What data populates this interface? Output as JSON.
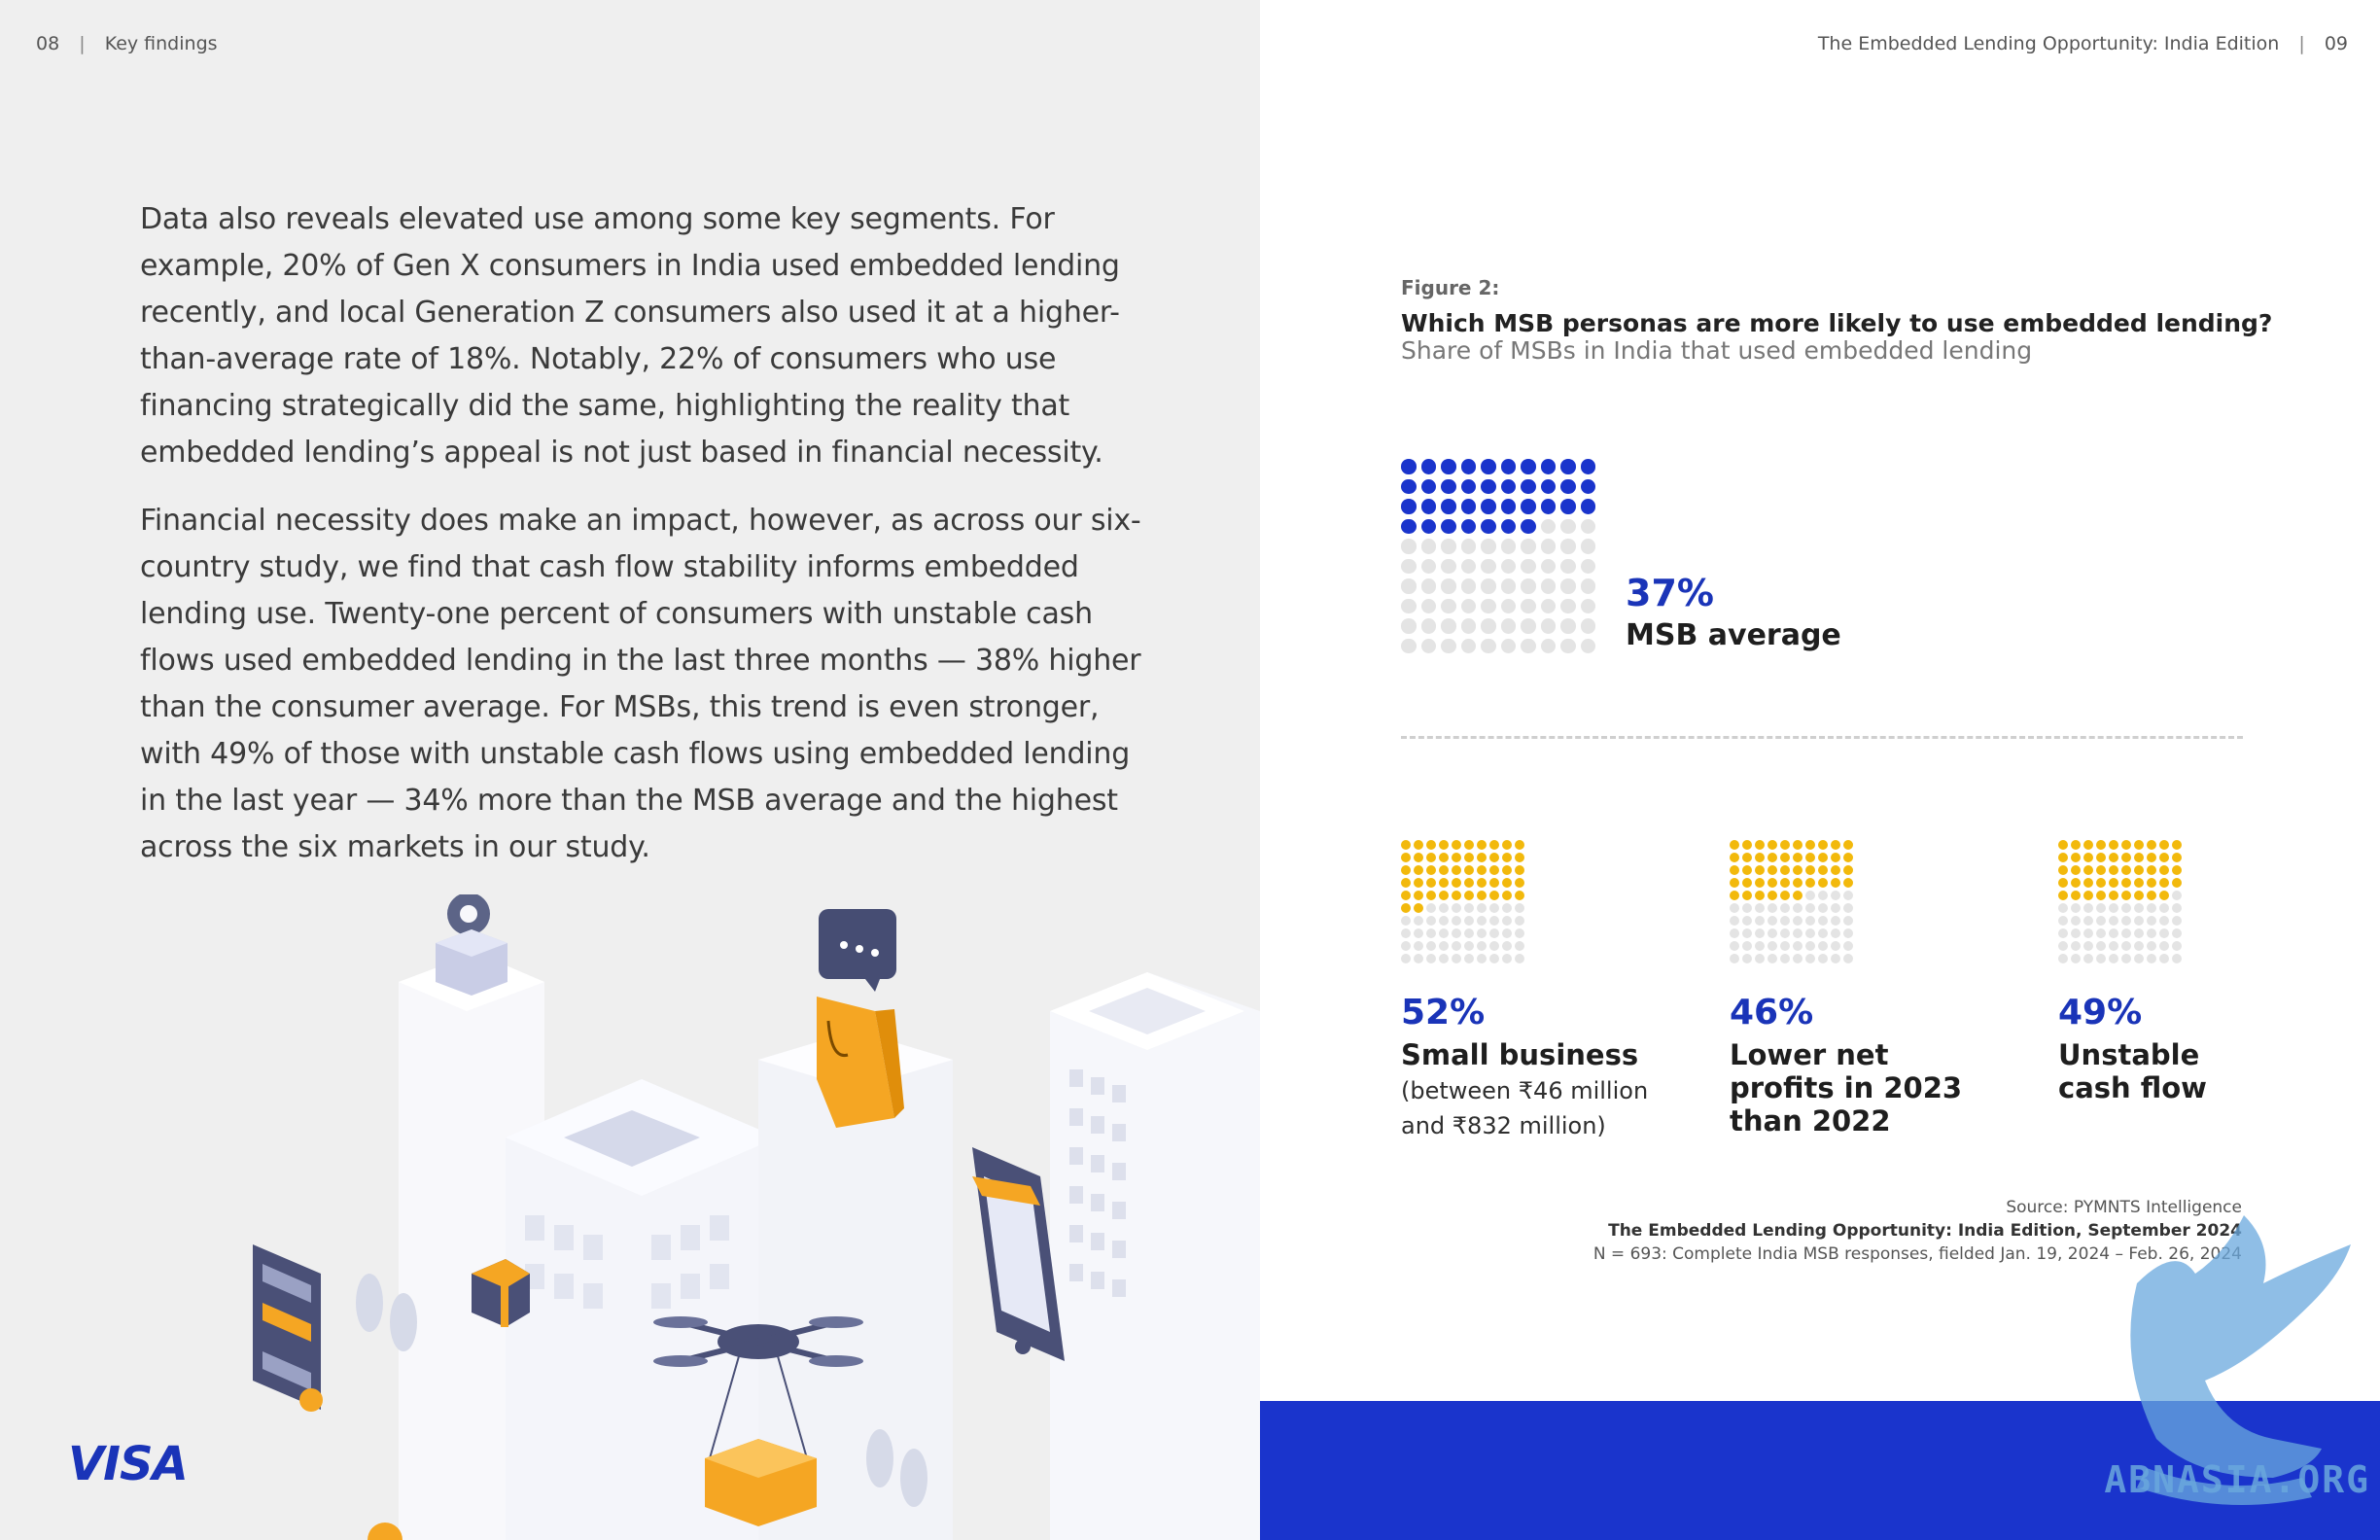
{
  "left_header": {
    "page_number": "08",
    "separator": "|",
    "section": "Key findings"
  },
  "right_header": {
    "title": "The Embedded Lending Opportunity: India Edition",
    "separator": "|",
    "page_number": "09"
  },
  "body": {
    "paragraph_1": "Data also reveals elevated use among some key segments. For example, 20% of Gen X consumers in India used embedded lending recently, and local Generation Z consumers also used it at a higher-than-average rate of 18%. Notably, 22% of consumers who use financing strategically did the same, highlighting the reality that embedded lending’s appeal is not just based in financial necessity.",
    "paragraph_2": "Financial necessity does make an impact, however, as across our six-country study, we find that cash flow stability informs embedded lending use. Twenty-one percent of consumers with unstable cash flows used embedded lending in the last three months — 38% higher than the consumer average. For MSBs, this trend is even stronger, with 49% of those with unstable cash flows using embedded lending in the last year — 34% more than the MSB average and the highest across the six markets in our study."
  },
  "logo": {
    "text": "VISA",
    "color": "#1a34b8"
  },
  "figure": {
    "label": "Figure 2:",
    "title": "Which MSB personas are more likely to use embedded lending?",
    "subtitle": "Share of MSBs in India that used embedded lending"
  },
  "chart_data": {
    "type": "waffle",
    "unit": "%",
    "average": {
      "value": 37,
      "value_label": "37%",
      "label": "MSB  average",
      "color": "#1a34cc"
    },
    "personas": [
      {
        "value": 52,
        "value_label": "52%",
        "label": "Small business",
        "sublabel": "(between ₹46 million and ₹832 million)",
        "color": "#f2b90c"
      },
      {
        "value": 46,
        "value_label": "46%",
        "label": "Lower net profits in 2023 than 2022",
        "sublabel": "",
        "color": "#f2b90c"
      },
      {
        "value": 49,
        "value_label": "49%",
        "label": "Unstable cash flow",
        "sublabel": "",
        "color": "#f2b90c"
      }
    ],
    "empty_color": "#e4e4e4"
  },
  "source": {
    "line_1": "Source: PYMNTS Intelligence",
    "line_2": "The Embedded Lending Opportunity: India Edition, September 2024",
    "line_3": "N = 693: Complete India MSB responses, fielded Jan. 19, 2024 – Feb. 26, 2024"
  },
  "watermark": {
    "text": "ABNASIA.ORG"
  },
  "colors": {
    "accent_blue": "#1a34cc",
    "accent_yellow": "#f2b90c",
    "left_bg": "#efefef"
  }
}
